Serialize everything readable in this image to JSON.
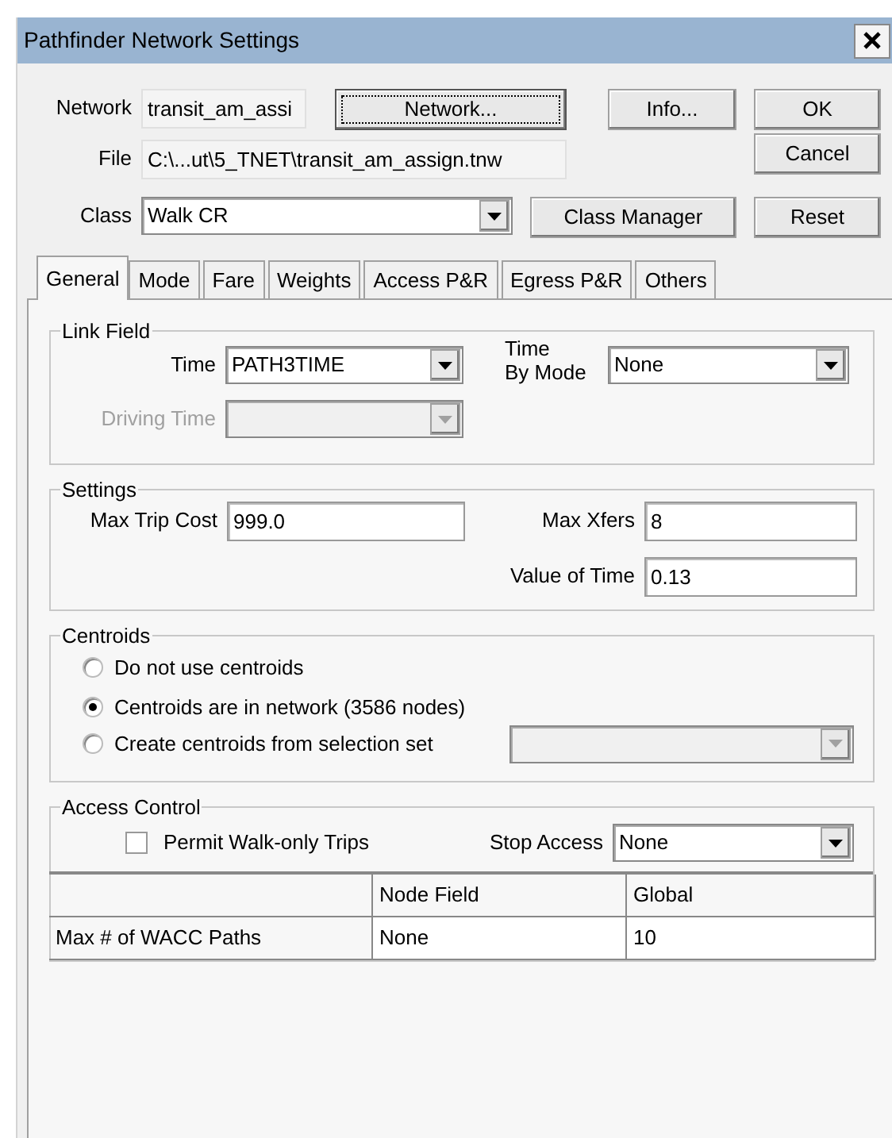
{
  "window": {
    "title": "Pathfinder Network Settings"
  },
  "network": {
    "label": "Network",
    "value": "transit_am_assi"
  },
  "file": {
    "label": "File",
    "value": "C:\\...ut\\5_TNET\\transit_am_assign.tnw"
  },
  "class": {
    "label": "Class",
    "value": "Walk CR"
  },
  "buttons": [
    {
      "label": "Network...",
      "focused": true
    },
    {
      "label": "Info...",
      "focused": false
    },
    {
      "label": "OK",
      "focused": false
    },
    {
      "label": "Cancel",
      "focused": false
    },
    {
      "label": "Class Manager",
      "focused": false
    },
    {
      "label": "Reset",
      "focused": false
    }
  ],
  "tabs": [
    {
      "label": "General",
      "selected": true
    },
    {
      "label": "Mode",
      "selected": false
    },
    {
      "label": "Fare",
      "selected": false
    },
    {
      "label": "Weights",
      "selected": false
    },
    {
      "label": "Access P&R",
      "selected": false
    },
    {
      "label": "Egress P&R",
      "selected": false
    },
    {
      "label": "Others",
      "selected": false
    }
  ],
  "link_field": {
    "title": "Link Field",
    "time": {
      "label": "Time",
      "value": "PATH3TIME",
      "disabled": false
    },
    "time_by_mode": {
      "label": "Time\nBy Mode",
      "value": "None",
      "disabled": false
    },
    "driving_time": {
      "label": "Driving Time",
      "disabled": true
    }
  },
  "settings": {
    "title": "Settings",
    "fields": [
      {
        "label": "Max Trip Cost",
        "value": "999.0"
      },
      {
        "label": "Max Xfers",
        "value": "8"
      },
      {
        "label": "Value of Time",
        "value": "0.13"
      }
    ]
  },
  "centroids": {
    "title": "Centroids",
    "options": [
      {
        "label": "Do not use centroids",
        "selected": false
      },
      {
        "label": "Centroids are in network (3586 nodes)",
        "selected": true
      },
      {
        "label": "Create centroids from selection set",
        "selected": false
      }
    ],
    "selection_set": {
      "disabled": true
    }
  },
  "access_control": {
    "title": "Access Control",
    "permit_walk_only": {
      "label": "Permit Walk-only Trips",
      "checked": false
    },
    "stop_access": {
      "label": "Stop Access",
      "value": "None",
      "disabled": false
    },
    "table": {
      "columns": [
        "Node Field",
        "Global"
      ],
      "rows": [
        {
          "label": "Max # of WACC Paths",
          "node_field": "None",
          "global": "10"
        }
      ]
    }
  }
}
